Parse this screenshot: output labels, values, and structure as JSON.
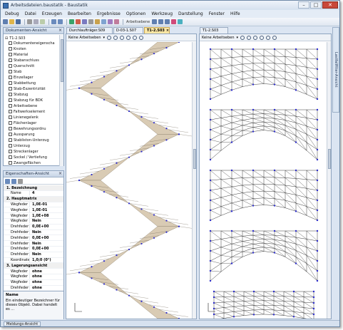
{
  "window": {
    "title": "Arbeitsdateien.baustatik - Baustatik"
  },
  "menu": [
    "Debug",
    "Datei",
    "Erzeugen",
    "Bearbeiten",
    "Ergebnisse",
    "Optionen",
    "Werkzeug",
    "Darstellung",
    "Fenster",
    "Hilfe"
  ],
  "toolbar": {
    "combo_value": "Arbeitsebene"
  },
  "doc_tree": {
    "title": "Dokumenten-Ansicht",
    "root": "T1-2.S03",
    "items": [
      "Dokumenteneigenscha",
      "Knoten",
      "Material",
      "Stabanschluss",
      "Querschnitt",
      "Stab",
      "Einzellager",
      "Stabbettung",
      "Stab-Exzentrizität",
      "Stabzug",
      "Stabzug für BDK",
      "Arbeitsebene",
      "Faltwerkselement",
      "Linienegelenk",
      "Flächenlager",
      "Bewehrungsordnu",
      "Aussparung",
      "Stabliston-Unterzug",
      "Unterzug",
      "Streckenlager",
      "Sockel / Vertiefung",
      "Zwangsflächen"
    ]
  },
  "props": {
    "title": "Eigenschaften-Ansicht",
    "rows": [
      {
        "type": "cat",
        "k": "1. Bezeichnung"
      },
      {
        "k": "Name",
        "v": "4"
      },
      {
        "type": "cat",
        "k": "2. Hauptmatrix"
      },
      {
        "k": "Wegfeder",
        "v": "1,0E-01"
      },
      {
        "k": "Wegfeder",
        "v": "1,0E-01"
      },
      {
        "k": "Wegfeder",
        "v": "1,0E+08"
      },
      {
        "k": "Wegfeder",
        "v": "Nein"
      },
      {
        "k": "Drehfeder",
        "v": "0,0E+00"
      },
      {
        "k": "Drehfeder",
        "v": "Nein"
      },
      {
        "k": "Drehfeder",
        "v": "0,0E+00"
      },
      {
        "k": "Drehfeder",
        "v": "Nein"
      },
      {
        "k": "Drehfeder",
        "v": "0,0E+00"
      },
      {
        "k": "Drehfeder",
        "v": "Nein"
      },
      {
        "k": "Koordinate",
        "v": "1,0;0 (0°)"
      },
      {
        "type": "cat",
        "k": "3. Lagerungsansicht"
      },
      {
        "k": "Wegfeder",
        "v": "ohne"
      },
      {
        "k": "Wegfeder",
        "v": "ohne"
      },
      {
        "k": "Wegfeder",
        "v": "ohne"
      },
      {
        "k": "Drehfeder",
        "v": "ohne"
      }
    ],
    "desc_title": "Name",
    "desc_text": "Ein eindeutiger Bezeichner für dieses Objekt. Dabei handelt es ..."
  },
  "tabs": [
    "Durchlaufträger.S09",
    "D-03-1.S07",
    "T1-2.S03",
    "T1-2.S03"
  ],
  "left_view": {
    "dropdown": "Keine Arbeitseben"
  },
  "right_view": {
    "dropdown": "Keine Arbeitseben"
  },
  "side_tab": "Lastfallfilter-Ansicht",
  "status_tab": "Meldungs-Ansicht",
  "colors": {
    "accent": "#fbe6a4",
    "mesh_fill": "#d9cbb4",
    "mesh_line": "#222222",
    "node": "#2c2ccc",
    "frame": "#8ea4bf"
  }
}
